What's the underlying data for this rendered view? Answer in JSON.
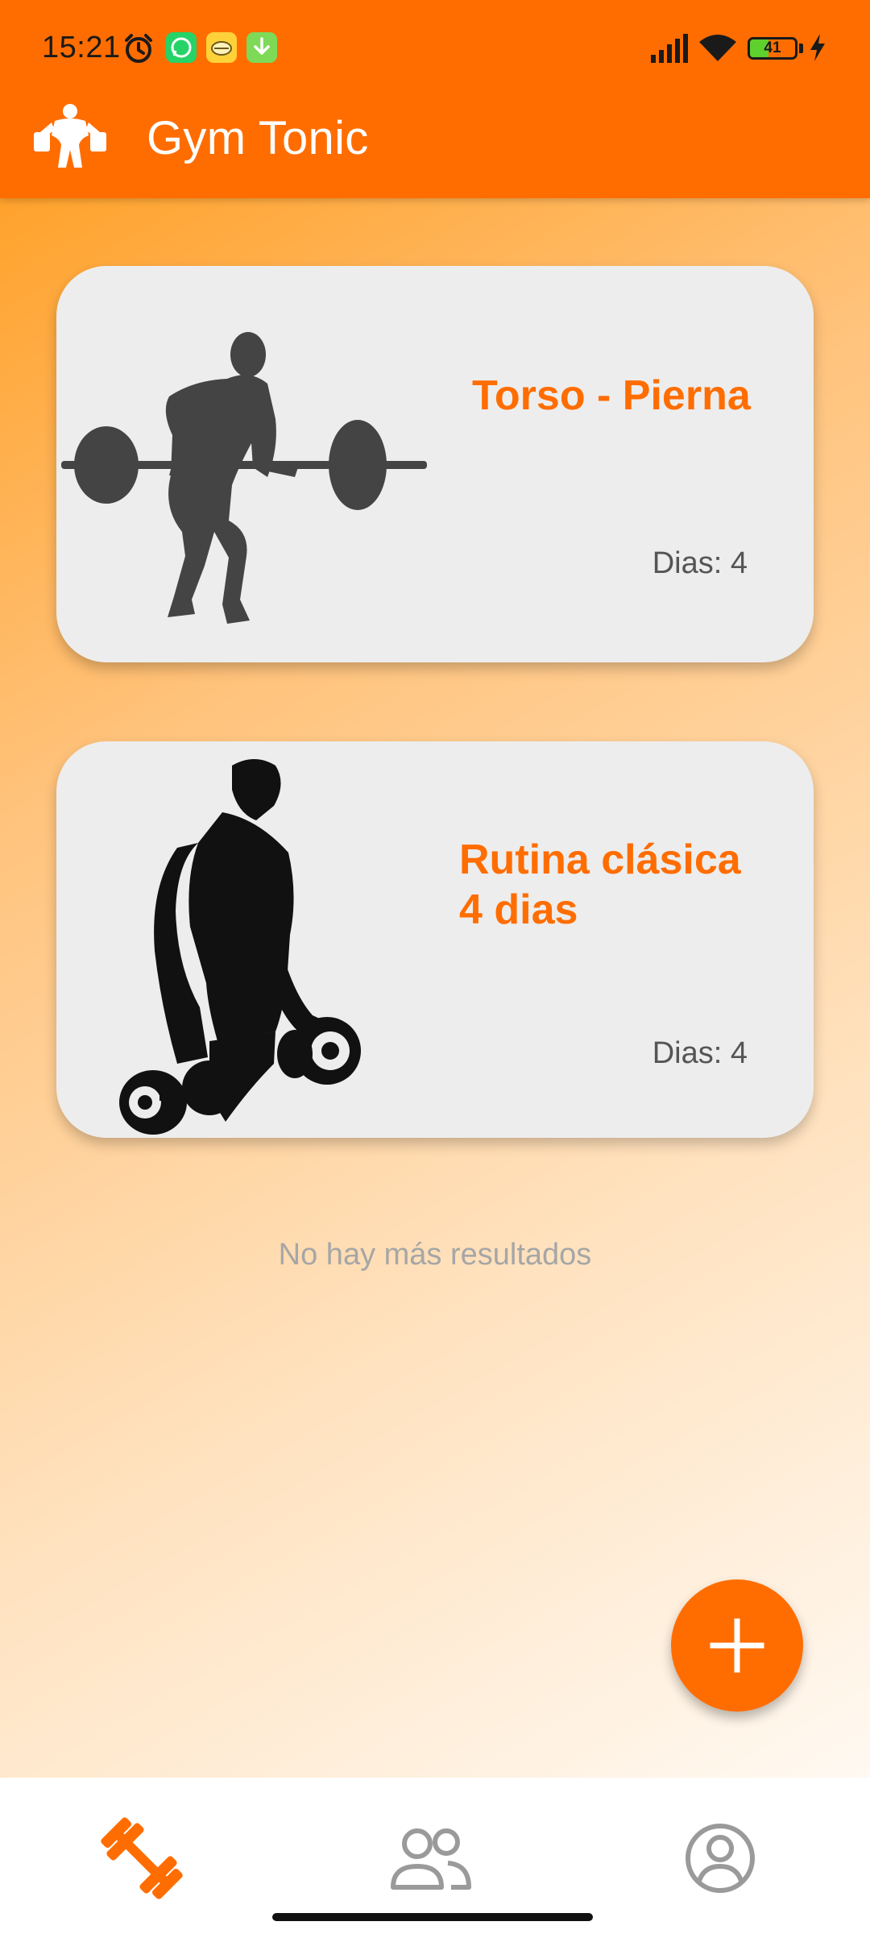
{
  "status_bar": {
    "time": "15:21",
    "battery_level": "41",
    "battery_fraction": 0.41,
    "notification_icons": [
      "alarm-icon",
      "whatsapp-icon",
      "app-notification-icon",
      "download-icon"
    ],
    "right_icons": [
      "signal-icon",
      "wifi-icon",
      "battery-icon",
      "charging-icon"
    ]
  },
  "app_bar": {
    "title": "Gym Tonic",
    "logo": "bodybuilder-logo-icon",
    "background": "#ff6d00"
  },
  "routines": [
    {
      "name": "Torso - Pierna",
      "days_label": "Dias:",
      "days_value": "4",
      "image": "barbell-lifter-silhouette"
    },
    {
      "name_line1": "Rutina clásica",
      "name_line2": "4 dias",
      "days_label": "Dias:",
      "days_value": "4",
      "image": "dumbbell-curl-silhouette"
    }
  ],
  "list_footer": "No hay más resultados",
  "fab": {
    "icon": "plus-icon",
    "color": "#ff6d00"
  },
  "bottom_nav": {
    "items": [
      {
        "icon": "dumbbell-icon",
        "active": true
      },
      {
        "icon": "people-icon",
        "active": false
      },
      {
        "icon": "account-circle-icon",
        "active": false
      }
    ],
    "active_color": "#ff6d00",
    "inactive_color": "#9a9a9a"
  }
}
